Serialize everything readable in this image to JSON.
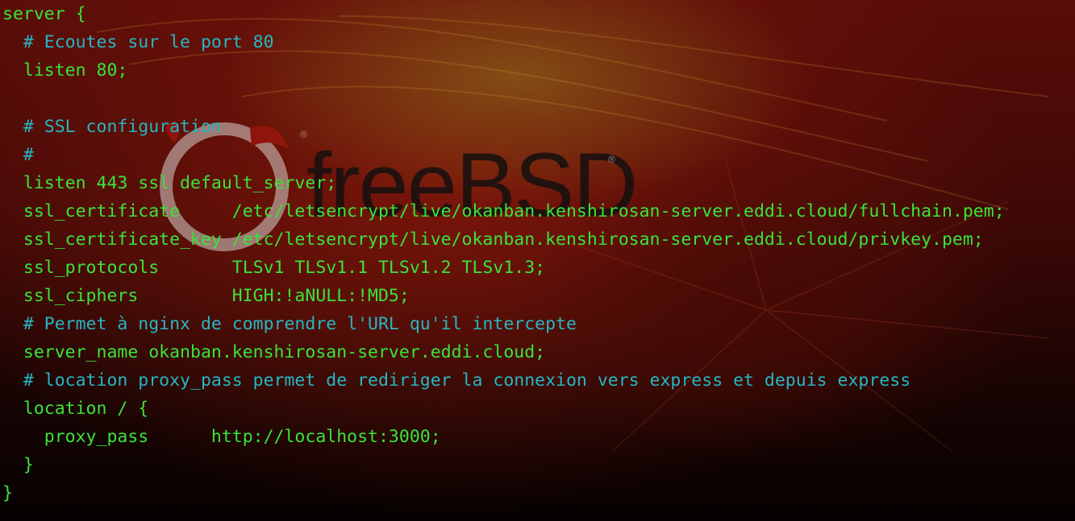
{
  "background": {
    "logo_text": "freeBSD",
    "logo_mark": "®"
  },
  "colors": {
    "code": "#3be33b",
    "comment": "#27b6c3",
    "background": "#3b0806"
  },
  "lines": [
    {
      "text": "server {",
      "type": "code"
    },
    {
      "text": "  # Ecoutes sur le port 80",
      "type": "comment"
    },
    {
      "text": "  listen 80;",
      "type": "code"
    },
    {
      "text": "",
      "type": "code"
    },
    {
      "text": "  # SSL configuration",
      "type": "comment"
    },
    {
      "text": "  #",
      "type": "comment"
    },
    {
      "text": "  listen 443 ssl default_server;",
      "type": "code"
    },
    {
      "text": "  ssl_certificate     /etc/letsencrypt/live/okanban.kenshirosan-server.eddi.cloud/fullchain.pem;",
      "type": "code"
    },
    {
      "text": "  ssl_certificate_key /etc/letsencrypt/live/okanban.kenshirosan-server.eddi.cloud/privkey.pem;",
      "type": "code"
    },
    {
      "text": "  ssl_protocols       TLSv1 TLSv1.1 TLSv1.2 TLSv1.3;",
      "type": "code"
    },
    {
      "text": "  ssl_ciphers         HIGH:!aNULL:!MD5;",
      "type": "code"
    },
    {
      "text": "  # Permet à nginx de comprendre l'URL qu'il intercepte",
      "type": "comment"
    },
    {
      "text": "  server_name okanban.kenshirosan-server.eddi.cloud;",
      "type": "code"
    },
    {
      "text": "  # location proxy_pass permet de rediriger la connexion vers express et depuis express",
      "type": "comment"
    },
    {
      "text": "  location / {",
      "type": "code"
    },
    {
      "text": "    proxy_pass      http://localhost:3000;",
      "type": "code"
    },
    {
      "text": "  }",
      "type": "code"
    },
    {
      "text": "}",
      "type": "code"
    }
  ]
}
